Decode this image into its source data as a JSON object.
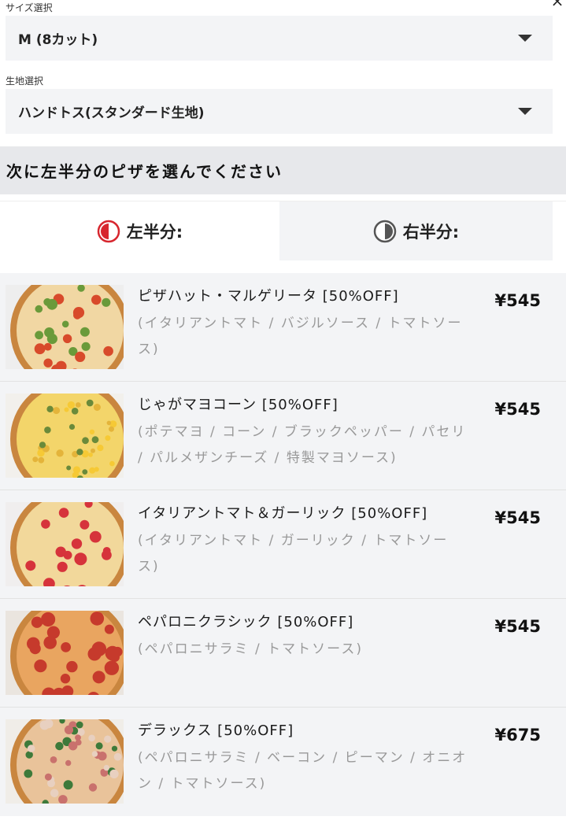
{
  "close": {
    "icon": "×"
  },
  "size": {
    "label": "サイズ選択",
    "value": "M (8カット)"
  },
  "crust": {
    "label": "生地選択",
    "value": "ハンドトス(スタンダード生地)"
  },
  "heading": "次に左半分のピザを選んでください",
  "tabs": [
    {
      "label": "左半分:",
      "icon": "left-half-icon",
      "color": "#d7262e"
    },
    {
      "label": "右半分:",
      "icon": "right-half-icon",
      "color": "#555555"
    }
  ],
  "pizzas": [
    {
      "name": "ピザハット・マルゲリータ [50%OFF]",
      "desc": "(イタリアントマト / バジルソース / トマトソース)",
      "price": "¥545",
      "topping": "margherita"
    },
    {
      "name": "じゃがマヨコーン [50%OFF]",
      "desc": "(ポテマヨ / コーン / ブラックペッパー / パセリ / パルメザンチーズ / 特製マヨソース)",
      "price": "¥545",
      "topping": "corn"
    },
    {
      "name": "イタリアントマト＆ガーリック [50%OFF]",
      "desc": "(イタリアントマト / ガーリック / トマトソース)",
      "price": "¥545",
      "topping": "tomato"
    },
    {
      "name": "ペパロニクラシック [50%OFF]",
      "desc": "(ペパロニサラミ / トマトソース)",
      "price": "¥545",
      "topping": "pepperoni"
    },
    {
      "name": "デラックス [50%OFF]",
      "desc": "(ペパロニサラミ / ベーコン / ピーマン / オニオン / トマトソース)",
      "price": "¥675",
      "topping": "deluxe"
    }
  ]
}
